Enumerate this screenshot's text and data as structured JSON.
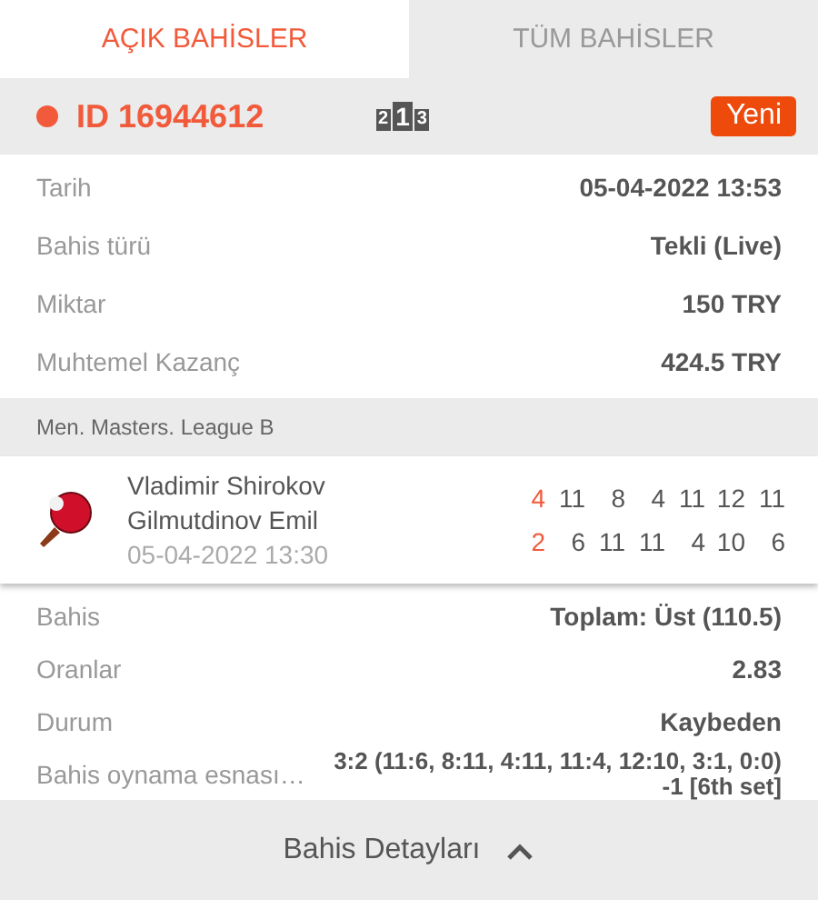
{
  "tabs": [
    {
      "label": "AÇIK BAHİSLER",
      "selected": true
    },
    {
      "label": "TÜM BAHİSLER",
      "selected": false
    }
  ],
  "bet_header": {
    "id": "ID 16944612",
    "podium": [
      "2",
      "1",
      "3"
    ],
    "badge": "Yeni"
  },
  "details": [
    {
      "label": "Tarih",
      "value": "05-04-2022 13:53"
    },
    {
      "label": "Bahis türü",
      "value": "Tekli (Live)"
    },
    {
      "label": "Miktar",
      "value": "150 TRY"
    },
    {
      "label": "Muhtemel Kazanç",
      "value": "424.5 TRY"
    }
  ],
  "league": "Men. Masters. League B",
  "match": {
    "home": "Vladimir Shirokov",
    "away": "Gilmutdinov Emil",
    "time": "05-04-2022 13:30",
    "scores": [
      [
        "4",
        "11",
        "8",
        "4",
        "11",
        "12",
        "11"
      ],
      [
        "2",
        "6",
        "11",
        "11",
        "4",
        "10",
        "6"
      ]
    ]
  },
  "selection": [
    {
      "label": "Bahis",
      "value": "Toplam: Üst (110.5)"
    },
    {
      "label": "Oranlar",
      "value": "2.83"
    },
    {
      "label": "Durum",
      "value": "Kaybeden"
    },
    {
      "label": "Bahis oynama esnası…",
      "value": "3:2 (11:6, 8:11, 4:11, 11:4, 12:10, 3:1, 0:0) -1 [6th set]"
    }
  ],
  "footer": {
    "label": "Bahis Detayları"
  }
}
